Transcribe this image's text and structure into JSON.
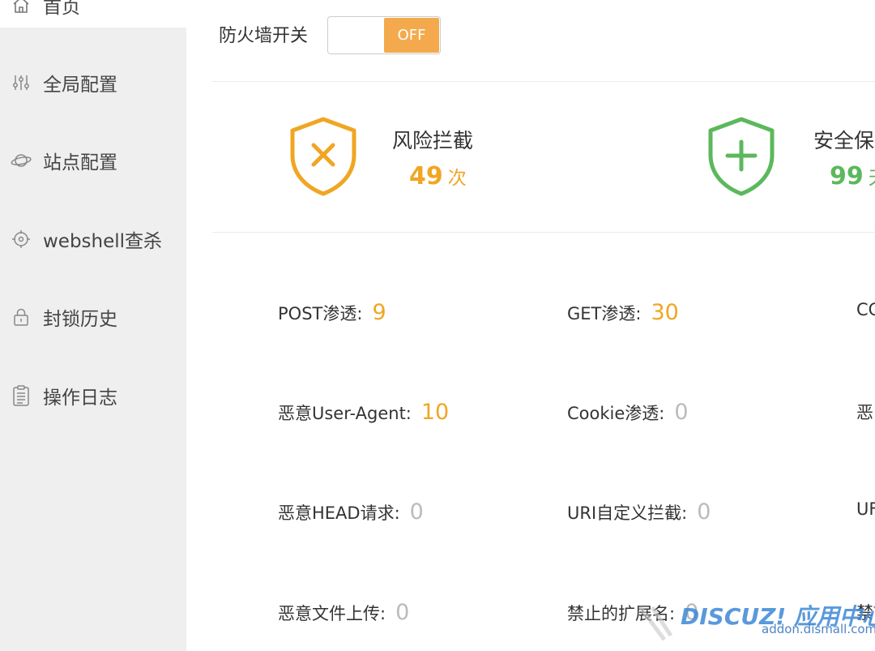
{
  "sidebar": {
    "items": [
      {
        "label": "首页",
        "icon": "home-icon",
        "active": true
      },
      {
        "label": "全局配置",
        "icon": "sliders-icon",
        "active": false
      },
      {
        "label": "站点配置",
        "icon": "planet-icon",
        "active": false
      },
      {
        "label": "webshell查杀",
        "icon": "crosshair-icon",
        "active": false
      },
      {
        "label": "封锁历史",
        "icon": "lock-icon",
        "active": false
      },
      {
        "label": "操作日志",
        "icon": "clipboard-icon",
        "active": false
      }
    ]
  },
  "firewall": {
    "label": "防火墙开关",
    "toggle_state": "OFF"
  },
  "stats": {
    "risk": {
      "title": "风险拦截",
      "value": "49",
      "unit": "次",
      "icon": "shield-x-icon",
      "color": "#f0a623"
    },
    "safe": {
      "title": "安全保",
      "value": "99",
      "unit": "天",
      "icon": "shield-plus-icon",
      "color": "#5cb85c"
    }
  },
  "metrics": [
    {
      "label": "POST渗透:",
      "value": "9",
      "highlight": true
    },
    {
      "label": "GET渗透:",
      "value": "30",
      "highlight": true
    },
    {
      "label": "CC",
      "value": "",
      "highlight": false
    },
    {
      "label": "恶意User-Agent:",
      "value": "10",
      "highlight": true
    },
    {
      "label": "Cookie渗透:",
      "value": "0",
      "highlight": false
    },
    {
      "label": "恶",
      "value": "",
      "highlight": false
    },
    {
      "label": "恶意HEAD请求:",
      "value": "0",
      "highlight": false
    },
    {
      "label": "URI自定义拦截:",
      "value": "0",
      "highlight": false
    },
    {
      "label": "UF",
      "value": "",
      "highlight": false
    },
    {
      "label": "恶意文件上传:",
      "value": "0",
      "highlight": false
    },
    {
      "label": "禁止的扩展名:",
      "value": "0",
      "highlight": false
    },
    {
      "label": "禁",
      "value": "",
      "highlight": false
    }
  ],
  "watermark": {
    "brand": "DISCUZ! 应用中心",
    "url": "addon.dismall.com"
  },
  "colors": {
    "accent_orange": "#f0a623",
    "toggle_orange": "#f4aa4c",
    "safe_green": "#5cb85c",
    "zero_gray": "#bbbbbb",
    "sidebar_bg": "#efefef"
  }
}
